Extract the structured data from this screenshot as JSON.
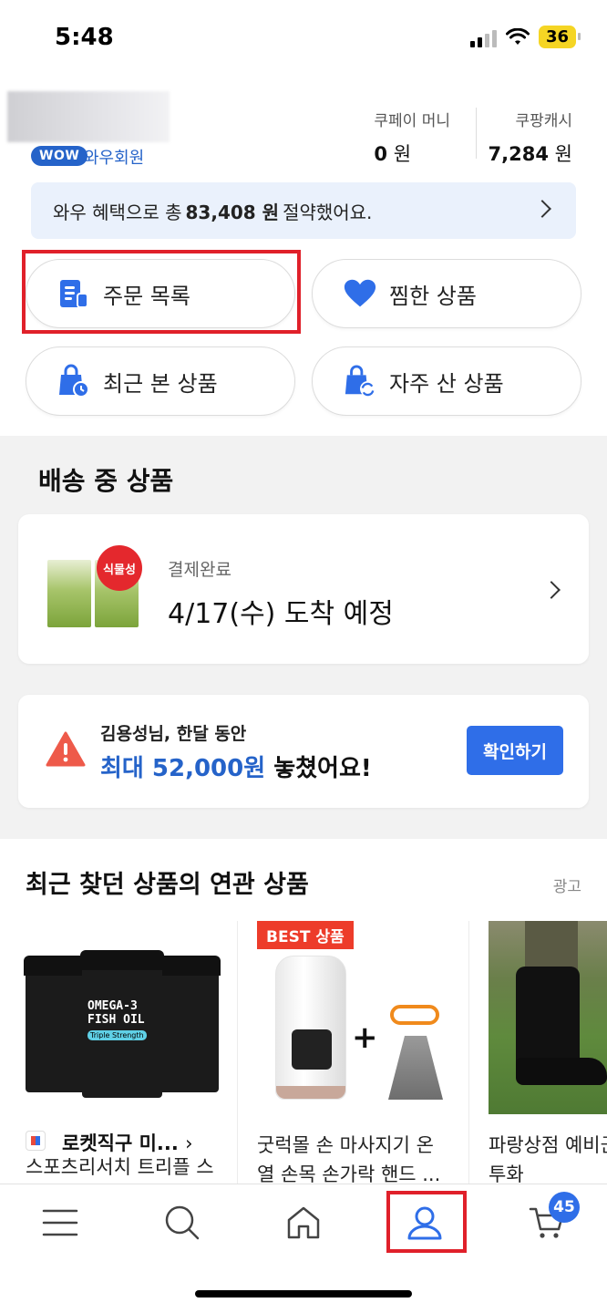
{
  "status_bar": {
    "time": "5:48",
    "battery": "36"
  },
  "profile": {
    "wow_badge": "WOW",
    "membership_label": "와우회원"
  },
  "wallet": {
    "coupay_money": {
      "title": "쿠페이 머니",
      "amount": "0",
      "unit": "원"
    },
    "coupang_cash": {
      "title": "쿠팡캐시",
      "amount": "7,284",
      "unit": "원"
    }
  },
  "savings_banner": {
    "prefix": "와우 혜택으로 총",
    "amount": "83,408 원",
    "suffix": "절약했어요."
  },
  "quick_menu": [
    {
      "label": "주문 목록",
      "icon": "order-list-icon"
    },
    {
      "label": "찜한 상품",
      "icon": "heart-icon"
    },
    {
      "label": "최근 본 상품",
      "icon": "recent-bag-icon"
    },
    {
      "label": "자주 산 상품",
      "icon": "repurchase-bag-icon"
    }
  ],
  "shipping": {
    "title": "배송 중 상품",
    "badge": "식물성",
    "status": "결제완료",
    "arrival": "4/17(수) 도착 예정"
  },
  "missed_savings": {
    "name_line": "김용성님, 한달 동안",
    "amount": "최대 52,000원",
    "suffix": "놓쳤어요!",
    "button": "확인하기"
  },
  "related": {
    "title": "최근 찾던 상품의 연관 상품",
    "ad_label": "광고",
    "items": [
      {
        "brand": "로켓직구 미...",
        "title": "스포츠리서치 트리플 스",
        "bottle_text": "OMEGA-3\nFISH OIL",
        "bottle_tag": "Triple Strength"
      },
      {
        "badge": "BEST 상품",
        "title_line1": "굿럭몰 손 마사지기 온",
        "title_line2": "열 손목 손가락 핸드 ..."
      },
      {
        "title_line1": "파랑상점 예비군",
        "title_line2": "투화"
      }
    ]
  },
  "tab_bar": {
    "items": [
      "menu",
      "search",
      "home",
      "my",
      "cart"
    ],
    "cart_count": "45"
  },
  "colors": {
    "accent": "#2563c9",
    "highlight": "#e0202a",
    "button": "#2f6ee8",
    "banner_bg": "#eaf1fc"
  }
}
